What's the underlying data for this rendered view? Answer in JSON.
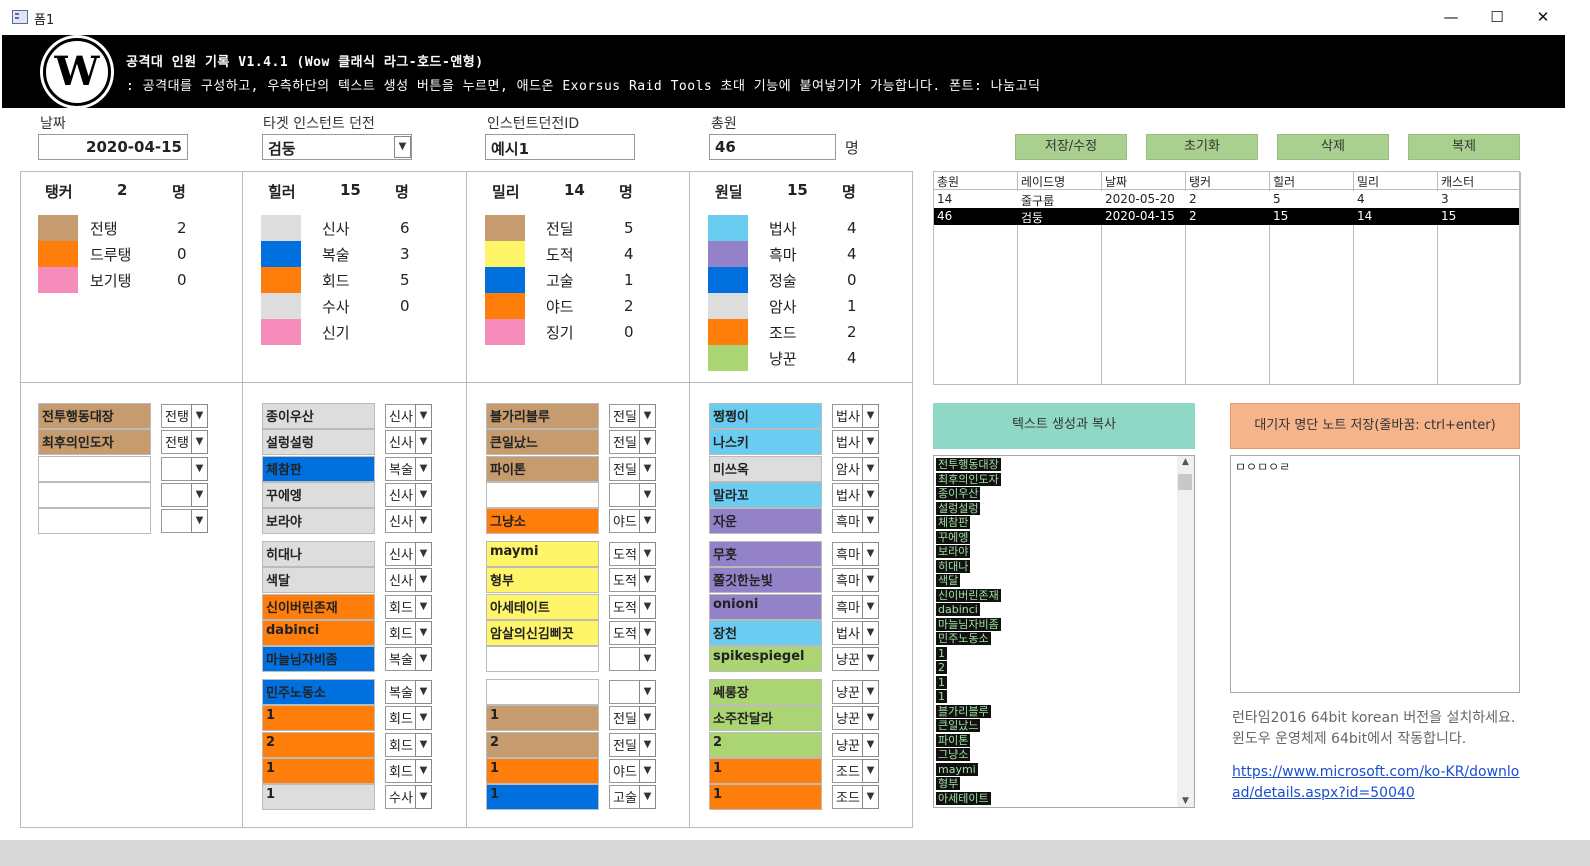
{
  "window": {
    "title": "폼1",
    "minimize": "—",
    "maximize": "☐",
    "close": "✕"
  },
  "header": {
    "logo_letter": "W",
    "title": "공격대 인원 기록 V1.4.1 (Wow 클래식 라그-호드-앤형)",
    "subtitle": ": 공격대를 구성하고, 우측하단의 텍스트 생성 버튼을 누르면, 애드온 Exorsus Raid Tools 초대 기능에 붙여넣기가 가능합니다. 폰트: 나눔고딕"
  },
  "form": {
    "date_label": "날짜",
    "date_value": "2020-04-15",
    "dungeon_label": "타겟 인스턴트 던전",
    "dungeon_value": "검둥",
    "instance_label": "인스턴트던전ID",
    "instance_value": "예시1",
    "total_label": "총원",
    "total_value": "46",
    "total_unit": "명"
  },
  "buttons": {
    "save": "저장/수정",
    "reset": "초기화",
    "delete": "삭제",
    "copy": "복제",
    "gen_text": "텍스트 생성과 복사",
    "save_notes": "대기자 명단 노트 저장(줄바꿈: ctrl+enter)"
  },
  "summary": {
    "tank": {
      "title": "탱커",
      "count": "2",
      "unit": "명",
      "rows": [
        {
          "label": "전탱",
          "n": "2",
          "color": "#c69b6d"
        },
        {
          "label": "드루탱",
          "n": "0",
          "color": "#ff7d0a"
        },
        {
          "label": "보기탱",
          "n": "0",
          "color": "#f58cba"
        }
      ]
    },
    "healer": {
      "title": "힐러",
      "count": "15",
      "unit": "명",
      "rows": [
        {
          "label": "신사",
          "n": "6",
          "color": "#dddddd"
        },
        {
          "label": "복술",
          "n": "3",
          "color": "#0070de"
        },
        {
          "label": "회드",
          "n": "5",
          "color": "#ff7d0a"
        },
        {
          "label": "수사",
          "n": "0",
          "color": "#dddddd"
        },
        {
          "label": "신기",
          "n": "",
          "color": "#f58cba"
        }
      ]
    },
    "melee": {
      "title": "밀리",
      "count": "14",
      "unit": "명",
      "rows": [
        {
          "label": "전딜",
          "n": "5",
          "color": "#c69b6d"
        },
        {
          "label": "도적",
          "n": "4",
          "color": "#fff569"
        },
        {
          "label": "고술",
          "n": "1",
          "color": "#0070de"
        },
        {
          "label": "야드",
          "n": "2",
          "color": "#ff7d0a"
        },
        {
          "label": "징기",
          "n": "0",
          "color": "#f58cba"
        }
      ]
    },
    "ranged": {
      "title": "원딜",
      "count": "15",
      "unit": "명",
      "rows": [
        {
          "label": "법사",
          "n": "4",
          "color": "#69ccf0"
        },
        {
          "label": "흑마",
          "n": "4",
          "color": "#9482c9"
        },
        {
          "label": "정술",
          "n": "0",
          "color": "#0070de"
        },
        {
          "label": "암사",
          "n": "1",
          "color": "#dddddd"
        },
        {
          "label": "조드",
          "n": "2",
          "color": "#ff7d0a"
        },
        {
          "label": "냥꾼",
          "n": "4",
          "color": "#abd473"
        }
      ]
    }
  },
  "raid_list": {
    "columns": [
      "총원",
      "레이드명",
      "날짜",
      "탱커",
      "힐러",
      "밀리",
      "캐스터"
    ],
    "rows": [
      [
        "14",
        "줄구룹",
        "2020-05-20",
        "2",
        "5",
        "4",
        "3"
      ],
      [
        "46",
        "검둥",
        "2020-04-15",
        "2",
        "15",
        "14",
        "15"
      ]
    ]
  },
  "slots": {
    "tank": [
      {
        "name": "전투행동대장",
        "role": "전탱",
        "color": "#c69b6d"
      },
      {
        "name": "최후의인도자",
        "role": "전탱",
        "color": "#c69b6d"
      },
      {
        "name": "",
        "role": "",
        "color": "#ffffff"
      },
      {
        "name": "",
        "role": "",
        "color": "#ffffff"
      },
      {
        "name": "",
        "role": "",
        "color": "#ffffff"
      }
    ],
    "healer1": [
      {
        "name": "종이우산",
        "role": "신사",
        "color": "#dddddd"
      },
      {
        "name": "설렁설렁",
        "role": "신사",
        "color": "#dddddd"
      },
      {
        "name": "체참판",
        "role": "복술",
        "color": "#0070de"
      },
      {
        "name": "꾸에엥",
        "role": "신사",
        "color": "#dddddd"
      },
      {
        "name": "보라야",
        "role": "신사",
        "color": "#dddddd"
      }
    ],
    "healer2": [
      {
        "name": "히대나",
        "role": "신사",
        "color": "#dddddd"
      },
      {
        "name": "색달",
        "role": "신사",
        "color": "#dddddd"
      },
      {
        "name": "신이버린존재",
        "role": "회드",
        "color": "#ff7d0a"
      },
      {
        "name": "dabinci",
        "role": "회드",
        "color": "#ff7d0a"
      },
      {
        "name": "마늘님자비좀",
        "role": "복술",
        "color": "#0070de"
      }
    ],
    "healer3": [
      {
        "name": "민주노동소",
        "role": "복술",
        "color": "#0070de"
      },
      {
        "name": "1",
        "role": "회드",
        "color": "#ff7d0a"
      },
      {
        "name": "2",
        "role": "회드",
        "color": "#ff7d0a"
      },
      {
        "name": "1",
        "role": "회드",
        "color": "#ff7d0a"
      },
      {
        "name": "1",
        "role": "수사",
        "color": "#dddddd"
      }
    ],
    "melee1": [
      {
        "name": "블가리블루",
        "role": "전딜",
        "color": "#c69b6d"
      },
      {
        "name": "큰일났느",
        "role": "전딜",
        "color": "#c69b6d"
      },
      {
        "name": "파이톤",
        "role": "전딜",
        "color": "#c69b6d"
      },
      {
        "name": "",
        "role": "",
        "color": "#ffffff"
      },
      {
        "name": "그냥소",
        "role": "야드",
        "color": "#ff7d0a"
      }
    ],
    "melee2": [
      {
        "name": "maymi",
        "role": "도적",
        "color": "#fff569"
      },
      {
        "name": "형부",
        "role": "도적",
        "color": "#fff569"
      },
      {
        "name": "아세테이트",
        "role": "도적",
        "color": "#fff569"
      },
      {
        "name": "암살의신김삐끗",
        "role": "도적",
        "color": "#fff569"
      },
      {
        "name": "",
        "role": "",
        "color": "#ffffff"
      }
    ],
    "melee3": [
      {
        "name": "",
        "role": "",
        "color": "#ffffff"
      },
      {
        "name": "1",
        "role": "전딜",
        "color": "#c69b6d"
      },
      {
        "name": "2",
        "role": "전딜",
        "color": "#c69b6d"
      },
      {
        "name": "1",
        "role": "야드",
        "color": "#ff7d0a"
      },
      {
        "name": "1",
        "role": "고술",
        "color": "#0070de"
      }
    ],
    "ranged1": [
      {
        "name": "쩡쩡이",
        "role": "법사",
        "color": "#69ccf0"
      },
      {
        "name": "나스키",
        "role": "법사",
        "color": "#69ccf0"
      },
      {
        "name": "미쓰옥",
        "role": "암사",
        "color": "#dddddd"
      },
      {
        "name": "말라꼬",
        "role": "법사",
        "color": "#69ccf0"
      },
      {
        "name": "자운",
        "role": "흑마",
        "color": "#9482c9"
      }
    ],
    "ranged2": [
      {
        "name": "무흣",
        "role": "흑마",
        "color": "#9482c9"
      },
      {
        "name": "쫄깃한눈빛",
        "role": "흑마",
        "color": "#9482c9"
      },
      {
        "name": "onioni",
        "role": "흑마",
        "color": "#9482c9"
      },
      {
        "name": "장천",
        "role": "법사",
        "color": "#69ccf0"
      },
      {
        "name": "spikespiegel",
        "role": "냥꾼",
        "color": "#abd473"
      }
    ],
    "ranged3": [
      {
        "name": "쎄롱장",
        "role": "냥꾼",
        "color": "#abd473"
      },
      {
        "name": "소주잔달라",
        "role": "냥꾼",
        "color": "#abd473"
      },
      {
        "name": "2",
        "role": "냥꾼",
        "color": "#abd473"
      },
      {
        "name": "1",
        "role": "조드",
        "color": "#ff7d0a"
      },
      {
        "name": "1",
        "role": "조드",
        "color": "#ff7d0a"
      }
    ]
  },
  "text_output": [
    "전투행동대장",
    "최후의인도자",
    "종이우산",
    "설렁설렁",
    "체참판",
    "꾸에엥",
    "보라야",
    "히대나",
    "색달",
    "신이버린존재",
    "dabinci",
    "마늘님자비좀",
    "민주노동소",
    "1",
    "2",
    "1",
    "1",
    "블가리블루",
    "큰일났느",
    "파이톤",
    "그냥소",
    "maymi",
    "형부",
    "아세테이트"
  ],
  "notes_text": "ㅁㅇㅁㅇㄹ",
  "info": {
    "text": "런타임2016 64bit korean 버전을 설치하세요. 윈도우 운영체제 64bit에서 작동합니다.",
    "link": "https://www.microsoft.com/ko-KR/download/details.aspx?id=50040"
  }
}
